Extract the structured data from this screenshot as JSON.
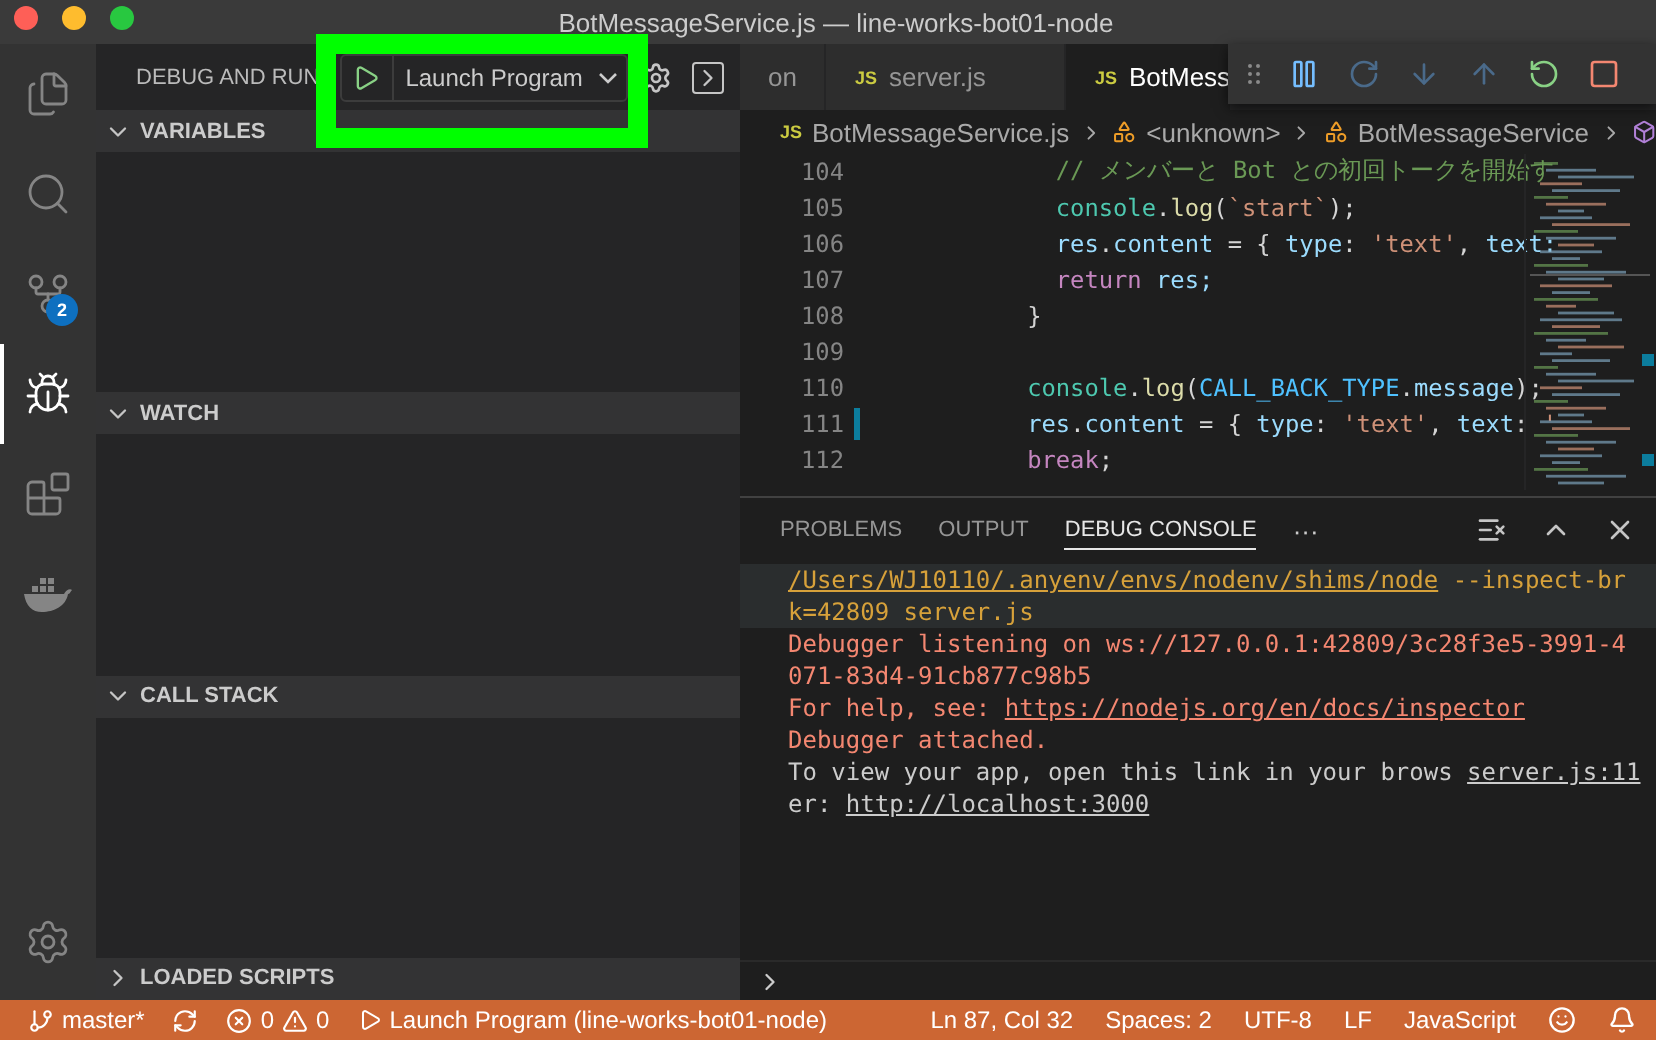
{
  "window": {
    "title": "BotMessageService.js — line-works-bot01-node"
  },
  "activity_bar": [
    {
      "kind": "explorer",
      "selected": false
    },
    {
      "kind": "search",
      "selected": false
    },
    {
      "kind": "scm",
      "selected": false,
      "badge": "2"
    },
    {
      "kind": "debug",
      "selected": true
    },
    {
      "kind": "extensions",
      "selected": false
    },
    {
      "kind": "docker",
      "selected": false
    }
  ],
  "sidebar": {
    "title": "DEBUG AND RUN",
    "launch_config": "Launch Program",
    "sections": [
      {
        "title": "VARIABLES",
        "expanded": true
      },
      {
        "title": "WATCH",
        "expanded": true
      },
      {
        "title": "CALL STACK",
        "expanded": true
      },
      {
        "title": "LOADED SCRIPTS",
        "expanded": false
      }
    ]
  },
  "tabs": [
    {
      "label": "on",
      "selected": false
    },
    {
      "label": "server.js",
      "selected": false,
      "icon": "JS"
    },
    {
      "label": "BotMess",
      "selected": true,
      "icon": "JS"
    }
  ],
  "breadcrumb": [
    {
      "label": "BotMessageService.js",
      "kind": "file",
      "icon": "JS"
    },
    {
      "label": "<unknown>",
      "kind": "symbol"
    },
    {
      "label": "BotMessageService",
      "kind": "symbol"
    },
    {
      "kind": "cube"
    }
  ],
  "code": [
    {
      "number": "104",
      "modified": false,
      "kind": "inner",
      "tokens": [
        {
          "text": "// メンバーと Bot との初回トークを開始す",
          "kind": "comment"
        }
      ]
    },
    {
      "number": "105",
      "modified": false,
      "kind": "inner",
      "tokens": [
        {
          "text": "console",
          "kind": "class"
        },
        {
          "text": ".",
          "kind": "punct"
        },
        {
          "text": "log",
          "kind": "function"
        },
        {
          "text": "(",
          "kind": "punct"
        },
        {
          "text": "`start`",
          "kind": "string"
        },
        {
          "text": ");",
          "kind": "punct"
        }
      ]
    },
    {
      "number": "106",
      "modified": false,
      "kind": "inner",
      "tokens": [
        {
          "text": "res",
          "kind": "variable"
        },
        {
          "text": ".",
          "kind": "punct"
        },
        {
          "text": "content",
          "kind": "variable"
        },
        {
          "text": " = { ",
          "kind": "punct"
        },
        {
          "text": "type",
          "kind": "variable"
        },
        {
          "text": ": ",
          "kind": "punct"
        },
        {
          "text": "'text'",
          "kind": "string"
        },
        {
          "text": ", ",
          "kind": "punct"
        },
        {
          "text": "text:",
          "kind": "variable"
        }
      ]
    },
    {
      "number": "107",
      "modified": false,
      "kind": "inner",
      "tokens": [
        {
          "text": "return",
          "kind": "keyword"
        },
        {
          "text": " res;",
          "kind": "variable"
        }
      ]
    },
    {
      "number": "108",
      "modified": false,
      "kind": "outer",
      "tokens": [
        {
          "text": "}",
          "kind": "punct"
        }
      ]
    },
    {
      "number": "109",
      "modified": false
    },
    {
      "number": "110",
      "modified": false,
      "kind": "outer",
      "tokens": [
        {
          "text": "console",
          "kind": "class"
        },
        {
          "text": ".",
          "kind": "punct"
        },
        {
          "text": "log",
          "kind": "function"
        },
        {
          "text": "(",
          "kind": "punct"
        },
        {
          "text": "CALL_BACK_TYPE",
          "kind": "constant"
        },
        {
          "text": ".",
          "kind": "punct"
        },
        {
          "text": "message",
          "kind": "variable"
        },
        {
          "text": ");",
          "kind": "punct"
        }
      ]
    },
    {
      "number": "111",
      "modified": true,
      "kind": "outer",
      "tokens": [
        {
          "text": "res",
          "kind": "variable"
        },
        {
          "text": ".",
          "kind": "punct"
        },
        {
          "text": "content",
          "kind": "variable"
        },
        {
          "text": " = { ",
          "kind": "punct"
        },
        {
          "text": "type",
          "kind": "variable"
        },
        {
          "text": ": ",
          "kind": "punct"
        },
        {
          "text": "'text'",
          "kind": "string"
        },
        {
          "text": ", ",
          "kind": "punct"
        },
        {
          "text": "text",
          "kind": "variable"
        },
        {
          "text": ": ",
          "kind": "punct"
        },
        {
          "text": "'",
          "kind": "string"
        }
      ]
    },
    {
      "number": "112",
      "modified": false,
      "kind": "outer",
      "tokens": [
        {
          "text": "break",
          "kind": "keyword"
        },
        {
          "text": ";",
          "kind": "punct"
        }
      ]
    }
  ],
  "panel": {
    "tabs": [
      {
        "label": "PROBLEMS",
        "selected": false
      },
      {
        "label": "OUTPUT",
        "selected": false
      },
      {
        "label": "DEBUG CONSOLE",
        "selected": true
      }
    ],
    "more": "···",
    "console": [
      {
        "kind": "command",
        "selected": true,
        "segments": [
          {
            "text": "/Users/WJ10110/.anyenv/envs/nodenv/shims/node",
            "link": true
          },
          {
            "text": " --inspect-brk=42809 server.js",
            "link": false
          }
        ]
      },
      {
        "kind": "error",
        "selected": false,
        "segments": [
          {
            "text": "Debugger listening on ws://127.0.0.1:42809/3c28f3e5-3991-4071-83d4-91cb877c98b5",
            "link": false
          }
        ]
      },
      {
        "kind": "error",
        "selected": false,
        "segments": [
          {
            "text": "For help, see: ",
            "link": false
          },
          {
            "text": "https://nodejs.org/en/docs/inspector",
            "link": true
          }
        ]
      },
      {
        "kind": "error",
        "selected": false,
        "segments": [
          {
            "text": "Debugger attached.",
            "link": false
          }
        ]
      },
      {
        "kind": "info",
        "selected": false,
        "source": "server.js:11",
        "segments": [
          {
            "text": "To view your app, open this link in your browser: ",
            "link": false
          },
          {
            "text": "http://localhost:3000",
            "link": true
          }
        ]
      }
    ]
  },
  "status_bar": {
    "branch": "master*",
    "errors": "0",
    "warnings": "0",
    "launch": "Launch Program (line-works-bot01-node)",
    "items": [
      "Ln 87, Col 32",
      "Spaces: 2",
      "UTF-8",
      "LF",
      "JavaScript"
    ]
  }
}
